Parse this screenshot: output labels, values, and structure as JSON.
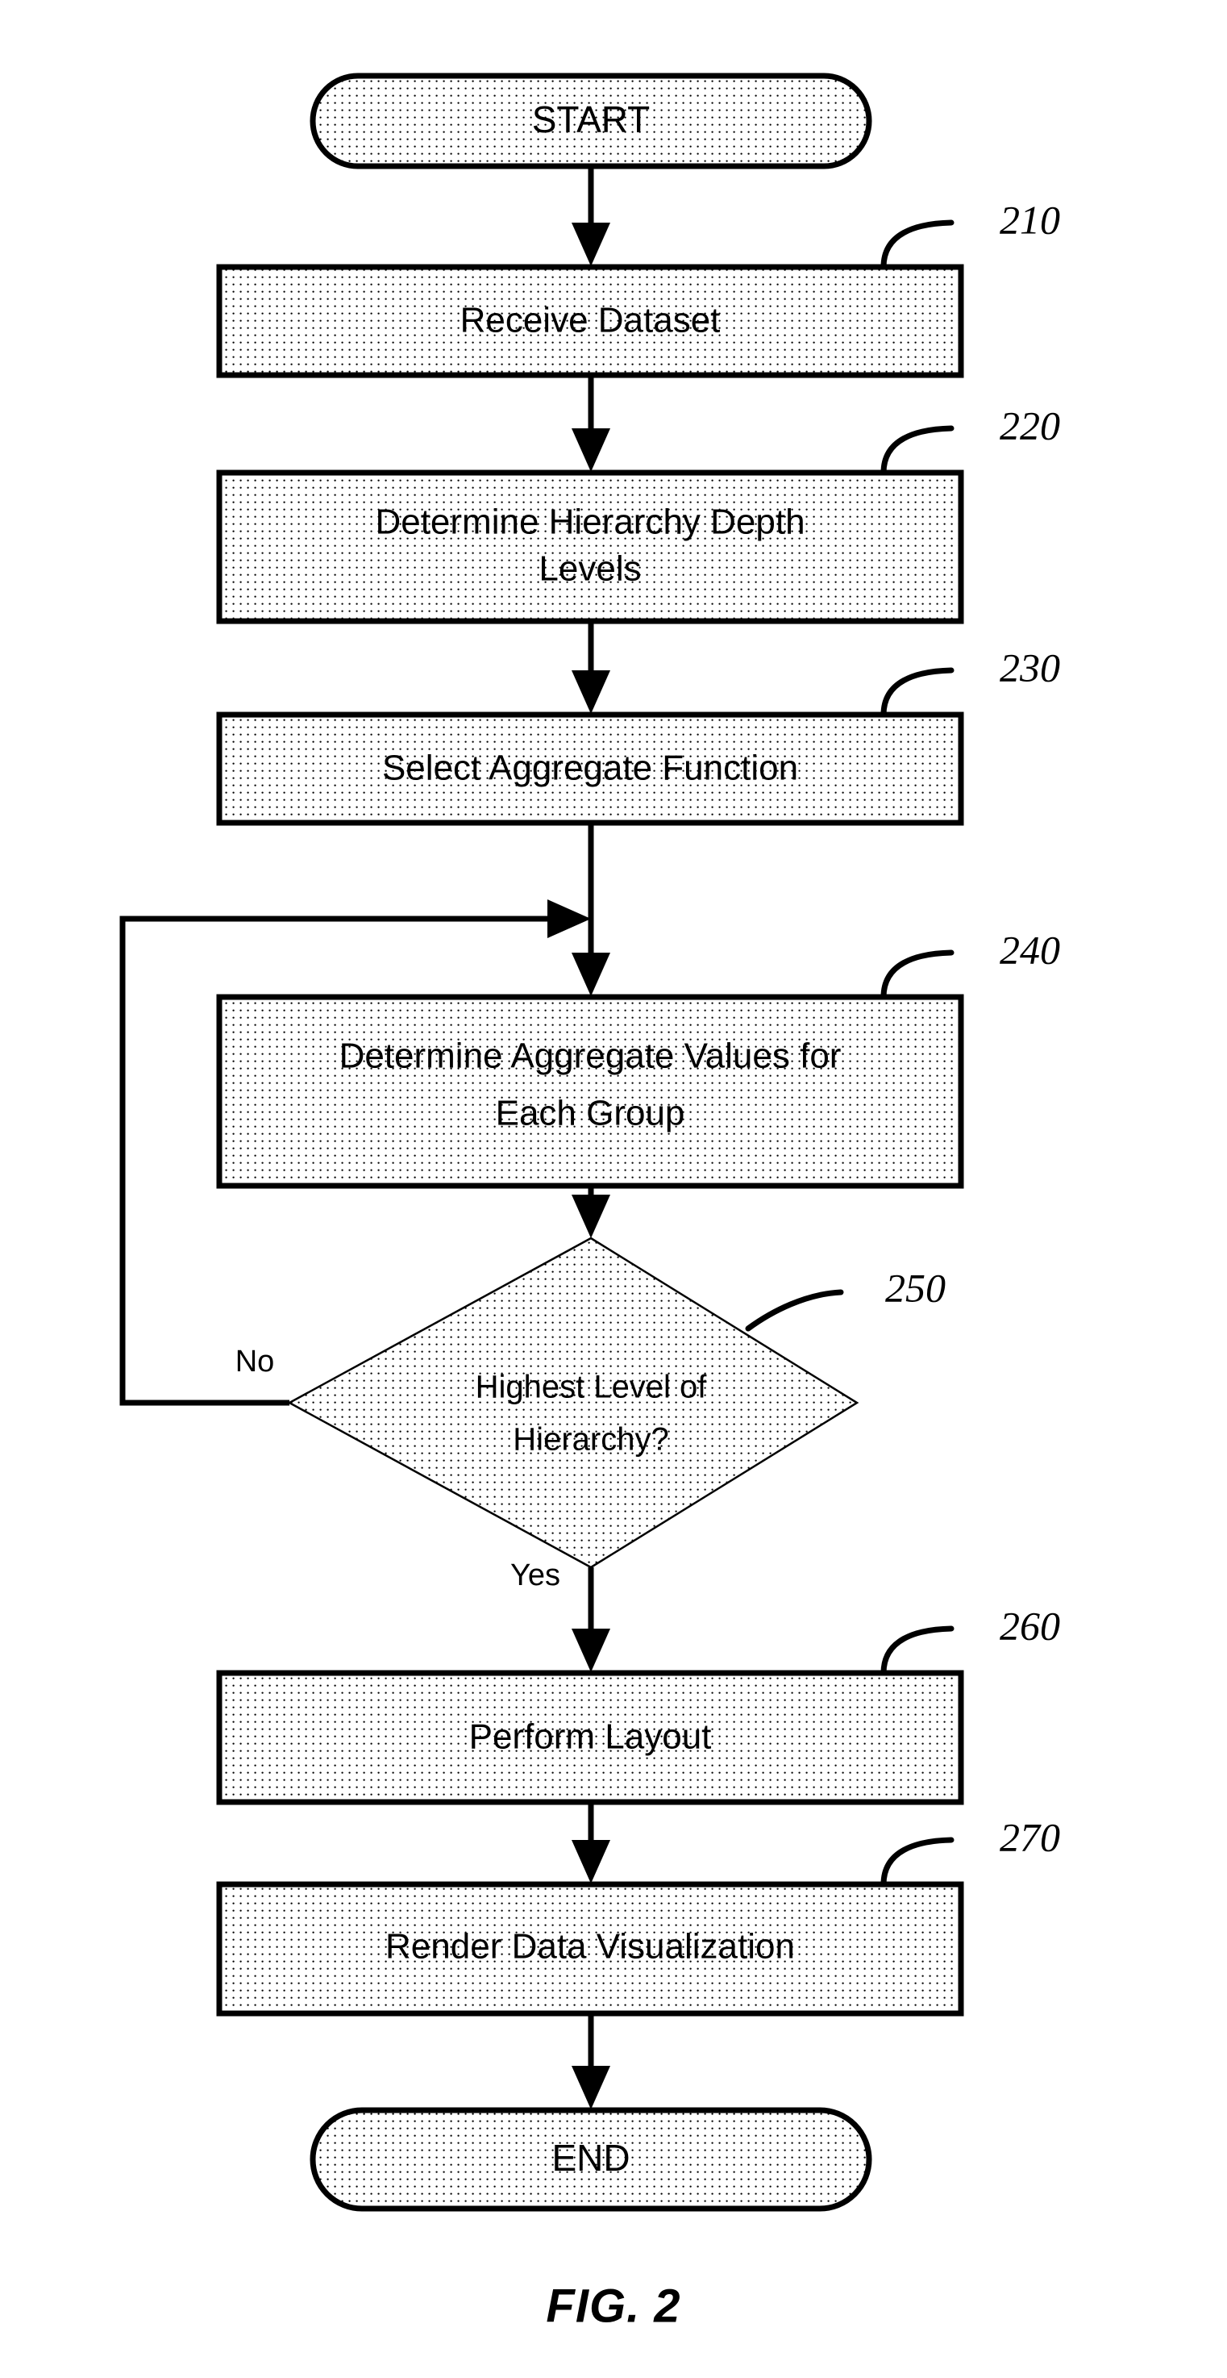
{
  "figure": {
    "caption": "FIG. 2",
    "background_color": "#ffffff",
    "line_color": "#000000",
    "fill_pattern": "dotted-stipple"
  },
  "nodes": {
    "start": {
      "label": "START",
      "type": "terminator",
      "ref": ""
    },
    "step210": {
      "label": "Receive Dataset",
      "type": "process",
      "ref": "210"
    },
    "step220_line1": {
      "label": "Determine Hierarchy Depth",
      "type": "process",
      "ref": "220"
    },
    "step220_line2": {
      "label": "Levels"
    },
    "step230": {
      "label": "Select Aggregate Function",
      "type": "process",
      "ref": "230"
    },
    "step240_line1": {
      "label": "Determine Aggregate Values for",
      "type": "process",
      "ref": "240"
    },
    "step240_line2": {
      "label": "Each Group"
    },
    "step250_line1": {
      "label": "Highest Level of",
      "type": "decision",
      "ref": "250"
    },
    "step250_line2": {
      "label": "Hierarchy?"
    },
    "step260": {
      "label": "Perform Layout",
      "type": "process",
      "ref": "260"
    },
    "step270": {
      "label": "Render Data Visualization",
      "type": "process",
      "ref": "270"
    },
    "end": {
      "label": "END",
      "type": "terminator",
      "ref": ""
    }
  },
  "ref_numbers": {
    "r210": "210",
    "r220": "220",
    "r230": "230",
    "r240": "240",
    "r250": "250",
    "r260": "260",
    "r270": "270"
  },
  "edge_labels": {
    "no": "No",
    "yes": "Yes"
  }
}
